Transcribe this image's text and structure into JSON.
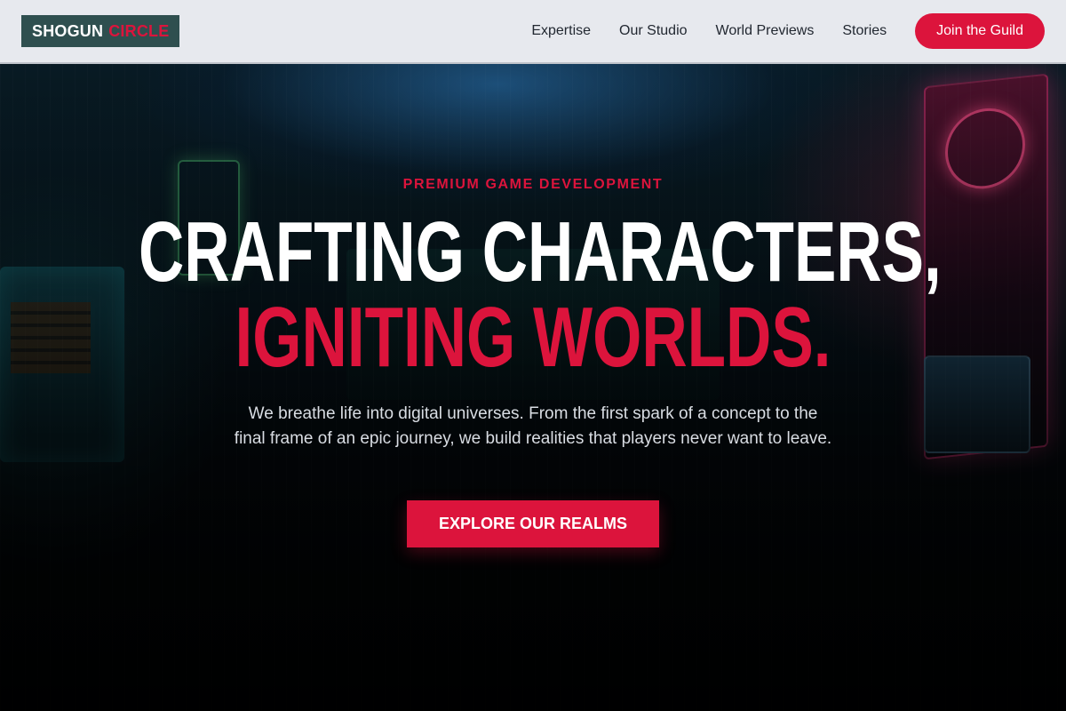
{
  "brand": {
    "part1": "SHOGUN",
    "part2": "CIRCLE"
  },
  "nav": {
    "links": [
      "Expertise",
      "Our Studio",
      "World Previews",
      "Stories"
    ],
    "cta_label": "Join the Guild"
  },
  "hero": {
    "eyebrow": "PREMIUM GAME DEVELOPMENT",
    "headline_line1": "CRAFTING CHARACTERS,",
    "headline_line2": "IGNITING WORLDS.",
    "subtext": "We breathe life into digital universes. From the first spark of a concept to the final frame of an epic journey, we build realities that players never want to leave.",
    "cta_label": "EXPLORE OUR REALMS"
  },
  "colors": {
    "accent": "#dc143c",
    "logo_bg": "#2f4f4f",
    "nav_bg": "#e7e9ee",
    "hero_text": "#ffffff"
  }
}
